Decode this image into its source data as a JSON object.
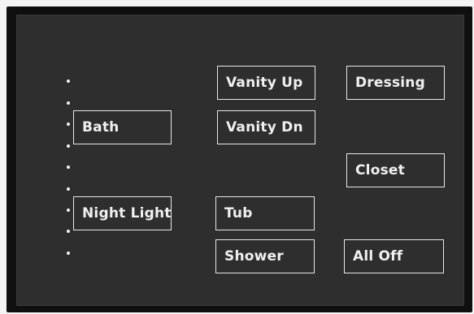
{
  "panel": {
    "background_color": "#2e2e2e",
    "border_color": "#e8e8e8",
    "text_color": "#f0f0f0"
  },
  "indicator_dots_count": 9,
  "buttons": {
    "bath": "Bath",
    "night_light": "Night Light",
    "vanity_up": "Vanity Up",
    "vanity_dn": "Vanity Dn",
    "tub": "Tub",
    "shower": "Shower",
    "dressing": "Dressing",
    "closet": "Closet",
    "all_off": "All Off"
  }
}
